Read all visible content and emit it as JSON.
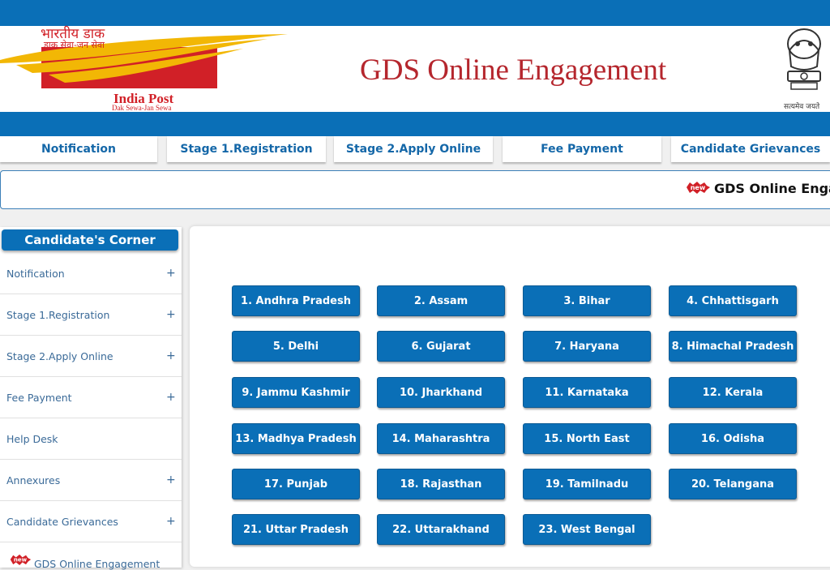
{
  "header": {
    "logo_hindi": "भारतीय डाक",
    "logo_hindi_tagline": "डाक सेवा-जन सेवा",
    "logo_english": "India Post",
    "logo_english_tagline": "Dak Sewa-Jan Sewa",
    "site_title": "GDS Online Engagement",
    "emblem_motto": "सत्यमेव जयते"
  },
  "nav": {
    "tabs": [
      {
        "label": "Notification"
      },
      {
        "label": "Stage 1.Registration"
      },
      {
        "label": "Stage 2.Apply Online"
      },
      {
        "label": "Fee Payment"
      },
      {
        "label": "Candidate Grievances"
      }
    ]
  },
  "ticker": {
    "badge": "new",
    "text": "GDS Online Engagement"
  },
  "sidebar": {
    "title": "Candidate's Corner",
    "items": [
      {
        "label": "Notification",
        "expand": "+"
      },
      {
        "label": "Stage 1.Registration",
        "expand": "+"
      },
      {
        "label": "Stage 2.Apply Online",
        "expand": "+"
      },
      {
        "label": "Fee Payment",
        "expand": "+"
      },
      {
        "label": "Help Desk",
        "expand": ""
      },
      {
        "label": "Annexures",
        "expand": "+"
      },
      {
        "label": "Candidate Grievances",
        "expand": "+"
      }
    ],
    "last_badge": "new",
    "last_item": "GDS Online Engagement"
  },
  "states": [
    "1. Andhra Pradesh",
    "2. Assam",
    "3. Bihar",
    "4. Chhattisgarh",
    "5. Delhi",
    "6. Gujarat",
    "7. Haryana",
    "8. Himachal Pradesh",
    "9. Jammu Kashmir",
    "10. Jharkhand",
    "11. Karnataka",
    "12. Kerala",
    "13. Madhya Pradesh",
    "14. Maharashtra",
    "15. North East",
    "16. Odisha",
    "17. Punjab",
    "18. Rajasthan",
    "19. Tamilnadu",
    "20. Telangana",
    "21. Uttar Pradesh",
    "22. Uttarakhand",
    "23. West Bengal"
  ],
  "colors": {
    "primary_blue": "#0a6fb7",
    "title_red": "#b5262d",
    "logo_yellow": "#f2b705",
    "logo_red": "#d12027"
  }
}
